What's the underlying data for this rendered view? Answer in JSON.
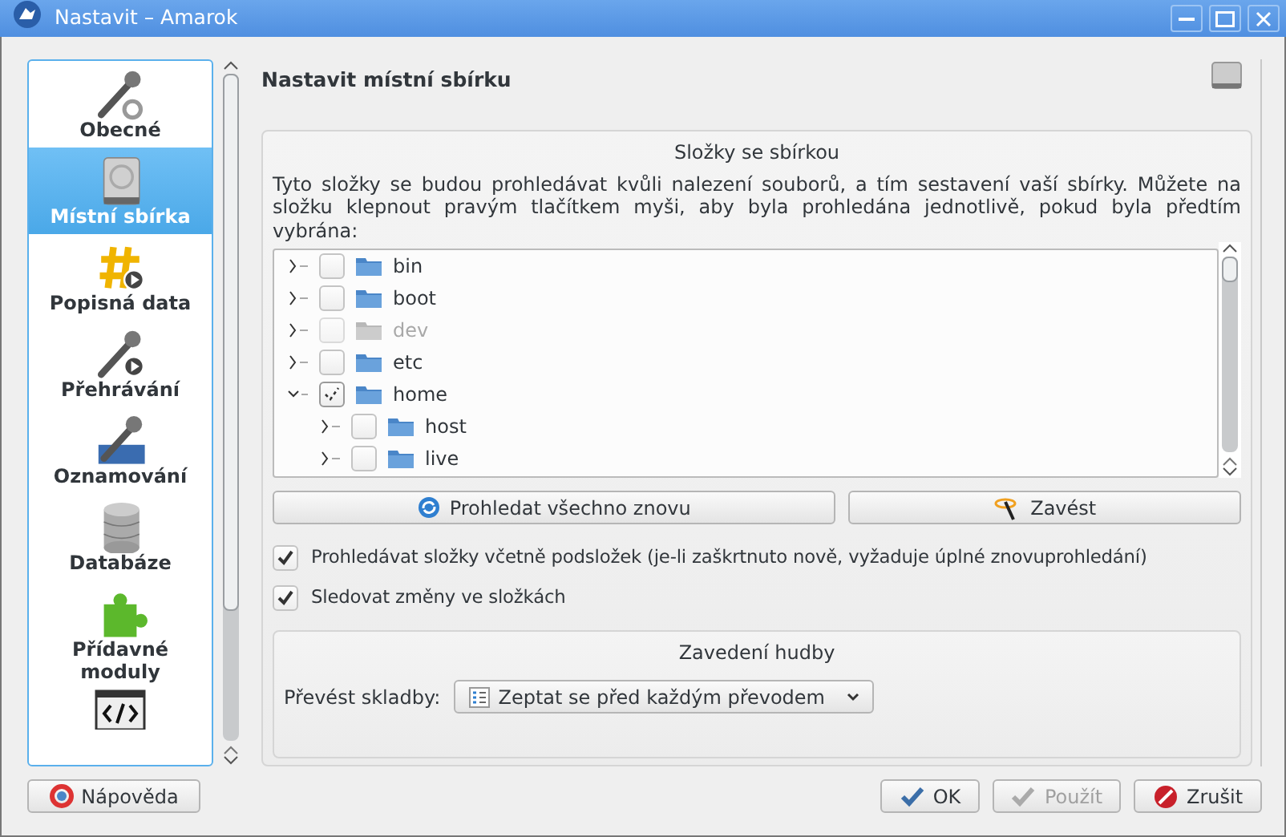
{
  "window": {
    "title": "Nastavit – Amarok"
  },
  "sidebar": {
    "items": [
      {
        "label": "Obecné",
        "selected": false
      },
      {
        "label": "Místní sbírka",
        "selected": true
      },
      {
        "label": "Popisná data",
        "selected": false
      },
      {
        "label": "Přehrávání",
        "selected": false
      },
      {
        "label": "Oznamování",
        "selected": false
      },
      {
        "label": "Databáze",
        "selected": false
      },
      {
        "label": "Přídavné moduly",
        "selected": false
      }
    ]
  },
  "page": {
    "title": "Nastavit místní sbírku"
  },
  "folders_group": {
    "title": "Složky se sbírkou",
    "description": "Tyto složky se budou prohledávat kvůli nalezení souborů, a tím sestavení vaší sbírky. Můžete na složku klepnout pravým tlačítkem myši, aby byla prohledána jednotlivě, pokud byla předtím vybrána:",
    "tree": [
      {
        "name": "bin",
        "checked": false,
        "partial": false,
        "disabled": false,
        "expanded": false
      },
      {
        "name": "boot",
        "checked": false,
        "partial": false,
        "disabled": false,
        "expanded": false
      },
      {
        "name": "dev",
        "checked": false,
        "partial": false,
        "disabled": true,
        "expanded": false
      },
      {
        "name": "etc",
        "checked": false,
        "partial": false,
        "disabled": false,
        "expanded": false
      },
      {
        "name": "home",
        "checked": true,
        "partial": true,
        "disabled": false,
        "expanded": true,
        "children": [
          {
            "name": "host",
            "checked": false,
            "partial": false,
            "disabled": false,
            "expanded": false
          },
          {
            "name": "live",
            "checked": false,
            "partial": false,
            "disabled": false,
            "expanded": false
          }
        ]
      }
    ]
  },
  "action_buttons": [
    {
      "label": "Prohledat všechno znovu"
    },
    {
      "label": "Zavést"
    }
  ],
  "options": [
    {
      "label": "Prohledávat složky včetně podsložek (je-li zaškrtnuto nově, vyžaduje úplné znovuprohledání)",
      "checked": true
    },
    {
      "label": "Sledovat změny ve složkách",
      "checked": true
    }
  ],
  "import_group": {
    "title": "Zavedení hudby",
    "label": "Převést skladby:",
    "value": "Zeptat se před každým převodem"
  },
  "help_button": {
    "label": "Nápověda"
  },
  "dialog_buttons": [
    {
      "label": "OK",
      "disabled": false,
      "kind": "ok"
    },
    {
      "label": "Použít",
      "disabled": true,
      "kind": "apply"
    },
    {
      "label": "Zrušit",
      "disabled": false,
      "kind": "cancel"
    }
  ]
}
